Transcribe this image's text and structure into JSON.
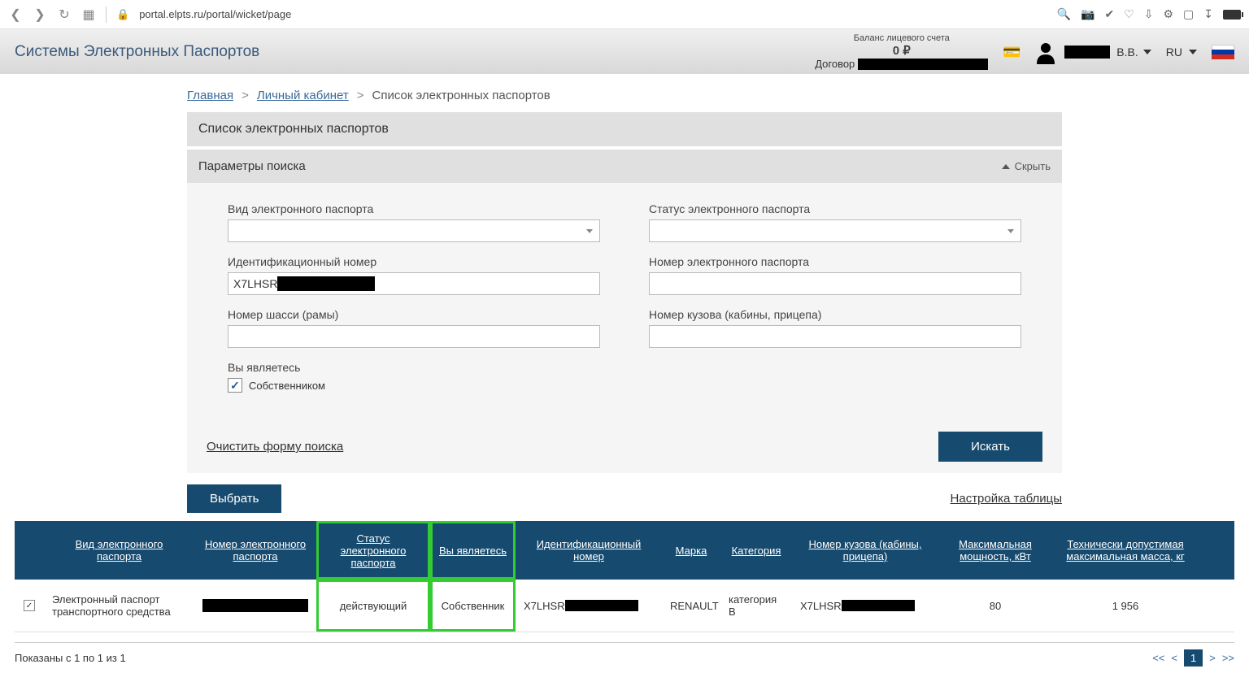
{
  "browser": {
    "url": "portal.elpts.ru/portal/wicket/page"
  },
  "header": {
    "title": "Системы Электронных Паспортов",
    "balance_label": "Баланс лицевого счета",
    "balance_value": "0 ₽",
    "contract_label": "Договор",
    "user_name": "В.В.",
    "lang": "RU"
  },
  "breadcrumb": {
    "home": "Главная",
    "cabinet": "Личный кабинет",
    "current": "Список электронных паспортов"
  },
  "panel": {
    "title": "Список электронных паспортов",
    "search_title": "Параметры поиска",
    "hide": "Скрыть"
  },
  "form": {
    "type_label": "Вид электронного паспорта",
    "status_label": "Статус электронного паспорта",
    "id_label": "Идентификационный номер",
    "id_value": "X7LHSR",
    "epass_num_label": "Номер электронного паспорта",
    "chassis_label": "Номер шасси (рамы)",
    "body_label": "Номер кузова (кабины, прицепа)",
    "you_are_label": "Вы являетесь",
    "owner": "Собственником",
    "clear": "Очистить форму поиска",
    "search_btn": "Искать"
  },
  "toolbar": {
    "select": "Выбрать",
    "settings": "Настройка таблицы"
  },
  "table": {
    "headers": {
      "type": "Вид электронного паспорта",
      "num": "Номер электронного паспорта",
      "status": "Статус электронного паспорта",
      "you": "Вы являетесь",
      "id": "Идентификационный номер",
      "brand": "Марка",
      "category": "Категория",
      "body": "Номер кузова (кабины, прицепа)",
      "power": "Максимальная мощность, кВт",
      "mass": "Технически допустимая максимальная масса, кг"
    },
    "row": {
      "type": "Электронный паспорт транспортного средства",
      "status": "действующий",
      "you": "Собственник",
      "id_prefix": "X7LHSR",
      "brand": "RENAULT",
      "category": "категория B",
      "body_prefix": "X7LHSR",
      "power": "80",
      "mass": "1 956"
    }
  },
  "footer": {
    "shown": "Показаны с 1 по 1 из 1",
    "page": "1"
  }
}
